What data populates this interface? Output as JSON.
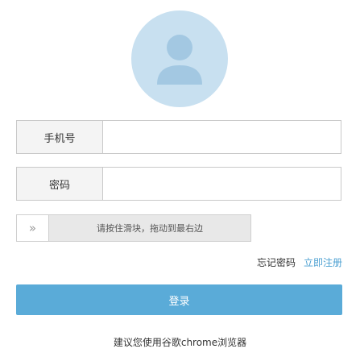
{
  "avatar": {
    "icon": "user-icon",
    "bg_color": "#c8e0f0",
    "fg_color": "#a3c8e2"
  },
  "form": {
    "phone_label": "手机号",
    "phone_value": "",
    "password_label": "密码",
    "password_value": ""
  },
  "slider": {
    "handle_icon": "double-chevron-right-icon",
    "handle_glyph": "»",
    "text": "请按住滑块，拖动到最右边"
  },
  "links": {
    "forgot": "忘记密码",
    "register": "立即注册"
  },
  "login_button": {
    "label": "登录",
    "color": "#5aabd8"
  },
  "tip": "建议您使用谷歌chrome浏览器"
}
